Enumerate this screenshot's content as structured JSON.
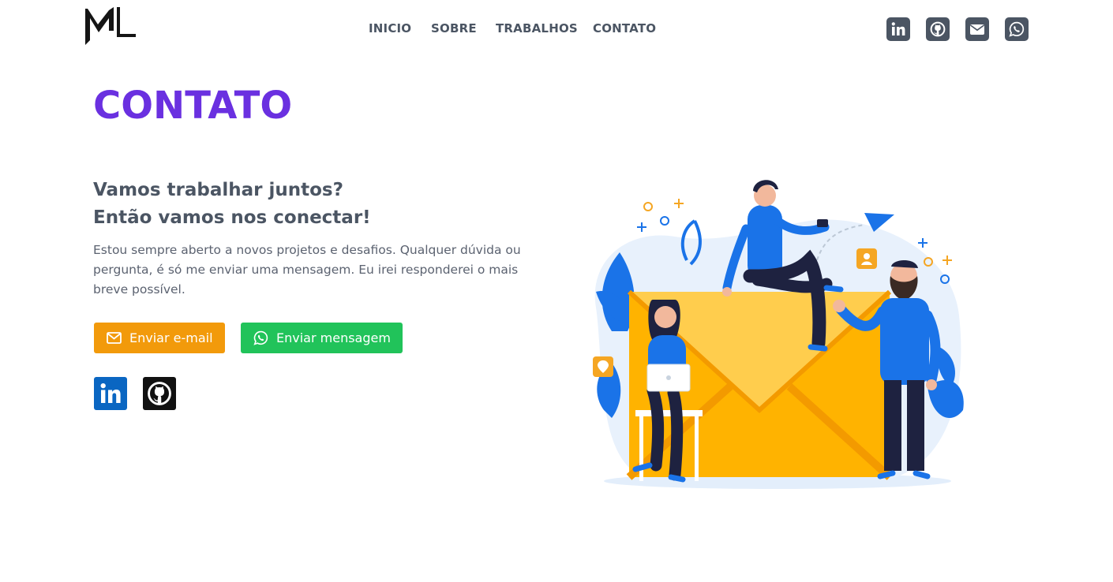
{
  "header": {
    "logo_text": "ML",
    "nav": [
      {
        "label": "INICIO"
      },
      {
        "label": "SOBRE"
      },
      {
        "label": "TRABALHOS"
      },
      {
        "label": "CONTATO"
      }
    ],
    "social": [
      {
        "icon": "linkedin-icon"
      },
      {
        "icon": "github-icon"
      },
      {
        "icon": "envelope-icon"
      },
      {
        "icon": "whatsapp-icon"
      }
    ]
  },
  "contact": {
    "title": "CONTATO",
    "subtitle_line1": "Vamos trabalhar juntos?",
    "subtitle_line2": "Então vamos nos conectar!",
    "description": "Estou sempre aberto a novos projetos e desafios. Qualquer dúvida ou pergunta, é só me enviar uma mensagem. Eu irei responderei o mais breve possível.",
    "email_button": "Enviar e-mail",
    "whatsapp_button": "Enviar mensagem",
    "social": [
      {
        "icon": "linkedin-icon"
      },
      {
        "icon": "github-icon"
      }
    ]
  },
  "colors": {
    "accent": "#6a30e0",
    "email_button": "#f29a0b",
    "whatsapp_button": "#21c35a",
    "linkedin": "#0a66c2",
    "github": "#111111",
    "nav_text": "#4b5563"
  }
}
